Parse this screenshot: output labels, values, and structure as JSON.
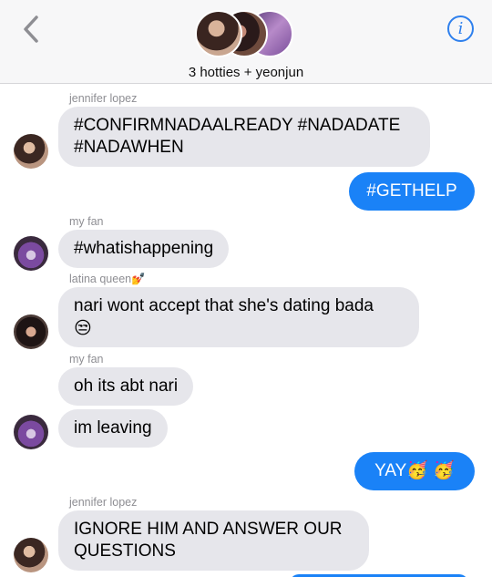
{
  "header": {
    "back_icon": "chevron-left-icon",
    "group_name": "3 hotties + yeonjun",
    "info_icon": "info-icon",
    "info_glyph": "i",
    "accent": "#2f80ed"
  },
  "messages": [
    {
      "sender": "jennifer lopez",
      "lines": [
        "#CONFIRMNADAALREADY #NADADATE",
        "#NADAWHEN"
      ]
    },
    {
      "outgoing": "#GETHELP"
    },
    {
      "sender": "my fan",
      "text": "#whatishappening"
    },
    {
      "sender": "latina queen💅",
      "lines": [
        "nari wont accept that she's dating bada",
        "😒"
      ]
    },
    {
      "sender": "my fan",
      "text": "oh its abt nari"
    },
    {
      "text": "im leaving"
    },
    {
      "outgoing": "YAY🥳 🥳"
    },
    {
      "sender": "jennifer lopez",
      "lines": [
        "IGNORE HIM AND ANSWER OUR",
        "QUESTIONS"
      ]
    }
  ],
  "colors": {
    "incoming_bubble": "#e6e6eb",
    "outgoing_bubble": "#1a82f7"
  }
}
